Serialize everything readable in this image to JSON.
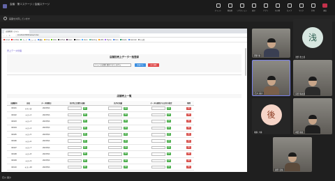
{
  "meeting": {
    "title": "会議 · 第１ステージ / 会議ステージ"
  },
  "toolbar": [
    {
      "label": "チャット",
      "icon": "chat-icon"
    },
    {
      "label": "参加者",
      "icon": "people-icon"
    },
    {
      "label": "リアクション",
      "icon": "reaction-icon"
    },
    {
      "label": "表示",
      "icon": "view-icon"
    },
    {
      "label": "アプリ",
      "icon": "apps-icon"
    },
    {
      "label": "その他",
      "icon": "more-icon"
    },
    {
      "label": "カメラ",
      "icon": "camera-icon"
    },
    {
      "label": "マイク",
      "icon": "mic-icon"
    },
    {
      "label": "共有",
      "icon": "share-icon"
    },
    {
      "label": "退出",
      "icon": "leave-icon"
    }
  ],
  "share_bar": {
    "label": "画面を共有しています"
  },
  "browser": {
    "tab_title": "店舗管理システム",
    "url": "localhost:8000/sales/index",
    "bookmarks": [
      {
        "label": "Gmail",
        "color": "#d93025"
      },
      {
        "label": "YouTube",
        "color": "#ff0000"
      },
      {
        "label": "マップ",
        "color": "#34a853"
      },
      {
        "label": "ニュース",
        "color": "#4285f4"
      },
      {
        "label": "翻訳",
        "color": "#4285f4"
      },
      {
        "label": "Drive",
        "color": "#fbbc04"
      },
      {
        "label": "Qiita",
        "color": "#55c500"
      },
      {
        "label": "GitHub",
        "color": "#333333"
      },
      {
        "label": "Slack",
        "color": "#4a154b"
      },
      {
        "label": "Notion",
        "color": "#000000"
      },
      {
        "label": "Zenn",
        "color": "#3ea8ff"
      },
      {
        "label": "Backlog",
        "color": "#42ce9f"
      },
      {
        "label": "AWS",
        "color": "#ff9900"
      },
      {
        "label": "Figma",
        "color": "#a259ff"
      },
      {
        "label": "Docs",
        "color": "#4285f4"
      },
      {
        "label": "Sheets",
        "color": "#0f9d58"
      },
      {
        "label": "Calendar",
        "color": "#4285f4"
      },
      {
        "label": "その他",
        "color": "#888888"
      }
    ]
  },
  "page": {
    "breadcrumb": "売上データ管理",
    "upload_section": {
      "title": "店舗別売上データ一括登録",
      "file_input": "ファイルを選択  選択されていません",
      "upload_button": "登録する",
      "delete_button": "全て削除"
    },
    "list_section": {
      "title": "店舗売上一覧"
    },
    "table": {
      "headers": [
        "店舗番号",
        "店名",
        "データ更新日",
        "先月売上目標の金額",
        "先月の実績",
        "データを更新する日付の指定",
        "削除"
      ],
      "update_label": "更新",
      "delete_label": "削除",
      "rows": [
        {
          "id": "00101",
          "name": "テスト店",
          "date": "2023/5/1"
        },
        {
          "id": "00102",
          "name": "テスト2",
          "date": "2023/5/1"
        },
        {
          "id": "00103",
          "name": "テスト3",
          "date": "2023/5/1"
        },
        {
          "id": "00104",
          "name": "テスト4",
          "date": "2023/5/1"
        },
        {
          "id": "00105",
          "name": "テスト5",
          "date": "2023/5/1"
        },
        {
          "id": "00106",
          "name": "テスト6",
          "date": "2023/5/1"
        },
        {
          "id": "00107",
          "name": "テスト7",
          "date": "2023/5/1"
        },
        {
          "id": "00108",
          "name": "テスト8",
          "date": "2023/5/1"
        },
        {
          "id": "00109",
          "name": "テスト9",
          "date": "2023/5/1"
        },
        {
          "id": "00110",
          "name": "テスト10",
          "date": "2023/5/1"
        },
        {
          "id": "00111",
          "name": "テスト11",
          "date": "2023/5/1"
        }
      ]
    }
  },
  "participants": [
    {
      "name": "西野 陽",
      "kind": "video",
      "shirt": "#3a3f52"
    },
    {
      "name": "浅野 貴士郎",
      "kind": "avatar",
      "initial": "浅",
      "color": "#d7e6e0",
      "text_color": "#2d5d4f"
    },
    {
      "name": "石川 美沙",
      "kind": "video",
      "shirt": "#7a5f4a",
      "active": true
    },
    {
      "name": "宮田 慎太郎",
      "kind": "video",
      "shirt": "#2b2b2b"
    },
    {
      "name": "後藤 大輔",
      "kind": "avatar",
      "initial": "後",
      "color": "#f6d5c8",
      "text_color": "#8a3a20"
    },
    {
      "name": "内田 健太",
      "kind": "video",
      "shirt": "#1f1f1f"
    },
    {
      "name": "森田 圭佑",
      "kind": "video",
      "shirt": "#5b4a3b"
    }
  ],
  "self_view": {
    "name": "石川 美沙"
  }
}
